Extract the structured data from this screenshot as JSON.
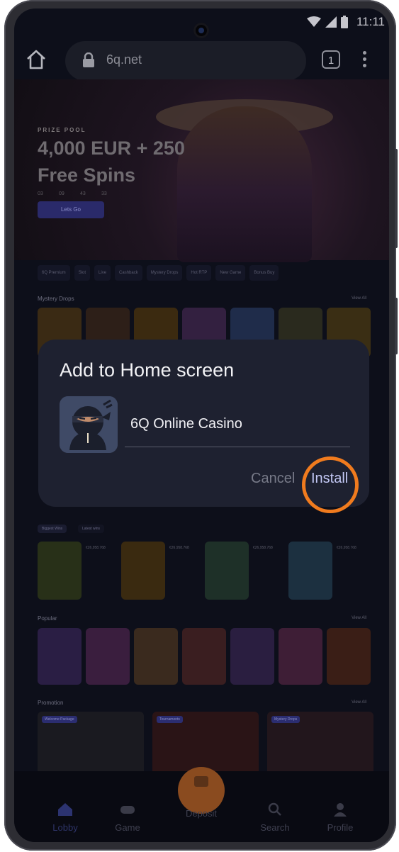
{
  "status_bar": {
    "time": "11:11"
  },
  "browser": {
    "url": "6q.net",
    "tab_count": "1"
  },
  "hero": {
    "label": "PRIZE POOL",
    "title": "4,000 EUR + 250 Free Spins",
    "timer": [
      "03",
      "09",
      "43",
      "33"
    ],
    "cta": "Lets Go"
  },
  "categories": [
    "6Q Premium",
    "Slot",
    "Live",
    "Cashback",
    "Mystery Drops",
    "Hot RTP",
    "New Game",
    "Bonus Buy"
  ],
  "sections": {
    "mystery_drops": "Mystery Drops",
    "popular": "Popular",
    "promotion": "Promotion",
    "view_all": "View All"
  },
  "feature_tabs": [
    "Biggest Wins",
    "Latest wins"
  ],
  "feature_items": [
    {
      "amount": "€26,958.768"
    },
    {
      "amount": "€26,958.768"
    },
    {
      "amount": "€26,958.768"
    },
    {
      "amount": "€26,958.768"
    }
  ],
  "promo_tags": [
    "Welcome Package",
    "Tournaments",
    "Mystery Drops"
  ],
  "bottom_nav": {
    "lobby": "Lobby",
    "game": "Game",
    "deposit": "Deposit",
    "search": "Search",
    "profile": "Profile"
  },
  "dialog": {
    "title": "Add to Home screen",
    "app_name": "6Q Online Casino",
    "cancel": "Cancel",
    "install": "Install"
  },
  "colors": {
    "highlight_ring": "#f07b1e",
    "dialog_bg": "#1e2130",
    "install_text": "#c3c8f5"
  }
}
